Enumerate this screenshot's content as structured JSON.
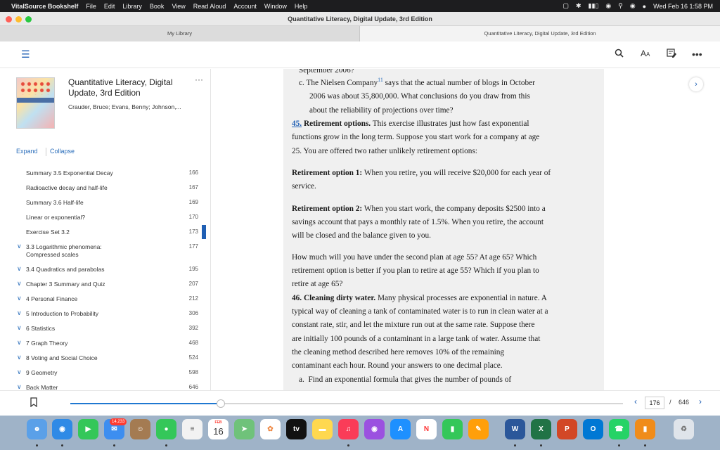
{
  "menubar": {
    "apple": "",
    "app": "VitalSource Bookshelf",
    "items": [
      "File",
      "Edit",
      "Library",
      "Book",
      "View",
      "Read Aloud",
      "Account",
      "Window",
      "Help"
    ],
    "clock": "Wed Feb 16  1:58 PM"
  },
  "window": {
    "title": "Quantitative Literacy, Digital Update,  3rd Edition",
    "tabs": [
      "My Library",
      "Quantitative Literacy, Digital Update,  3rd Edition"
    ]
  },
  "sidebar": {
    "book_title": "Quantitative Literacy, Digital Update,  3rd Edition",
    "authors": "Crauder, Bruce; Evans, Benny; Johnson,...",
    "more": "···",
    "expand": "Expand",
    "collapse": "Collapse",
    "toc": [
      {
        "label": "Summary 3.5 Exponential Decay",
        "page": "166",
        "chev": ""
      },
      {
        "label": "Radioactive decay and half-life",
        "page": "167",
        "chev": ""
      },
      {
        "label": "Summary 3.6 Half-life",
        "page": "169",
        "chev": ""
      },
      {
        "label": "Linear or exponential?",
        "page": "170",
        "chev": ""
      },
      {
        "label": "Exercise Set 3.2",
        "page": "173",
        "chev": ""
      },
      {
        "label": "3.3 Logarithmic phenomena:",
        "label2": "Compressed scales",
        "page": "177",
        "chev": "∨"
      },
      {
        "label": "3.4 Quadratics and parabolas",
        "page": "195",
        "chev": "∨"
      },
      {
        "label": "Chapter 3 Summary and Quiz",
        "page": "207",
        "chev": "∨"
      },
      {
        "label": "4 Personal Finance",
        "page": "212",
        "chev": "∨"
      },
      {
        "label": "5 Introduction to Probability",
        "page": "306",
        "chev": "∨"
      },
      {
        "label": "6 Statistics",
        "page": "392",
        "chev": "∨"
      },
      {
        "label": "7 Graph Theory",
        "page": "468",
        "chev": "∨"
      },
      {
        "label": "8 Voting and Social Choice",
        "page": "524",
        "chev": "∨"
      },
      {
        "label": "9 Geometry",
        "page": "598",
        "chev": "∨"
      },
      {
        "label": "Back Matter",
        "page": "646",
        "chev": "∨"
      }
    ]
  },
  "content": {
    "l0": "September 2006?",
    "c_label": "c.",
    "c_1a": "The Nielsen Company",
    "c_sup": "11",
    "c_1b": " says that the actual number of blogs in October",
    "c_2": "2006 was about 35,800,000. What conclusions do you draw from this",
    "c_3": "about the reliability of projections over time?",
    "q45_num": "45.",
    "q45_title": " Retirement options.",
    "q45_1": " This exercise illustrates just how fast exponential",
    "q45_2": "functions grow in the long term. Suppose you start work for a company at age",
    "q45_3": "25. You are offered two rather unlikely retirement options:",
    "opt1_title": "Retirement option 1:",
    "opt1_1": " When you retire, you will receive $20,000 for each year of",
    "opt1_2": "service.",
    "opt2_title": "Retirement option 2:",
    "opt2_1": " When you start work, the company deposits $2500 into a",
    "opt2_2": "savings account that pays a monthly rate of 1.5%. When you retire, the account",
    "opt2_3": "will be closed and the balance given to you.",
    "q_1": "How much will you have under the second plan at age 55? At age 65? Which",
    "q_2": "retirement option is better if you plan to retire at age 55? Which if you plan to",
    "q_3": "retire at age 65?",
    "q46_title": "46. Cleaning dirty water.",
    "q46_1": " Many physical processes are exponential in nature. A",
    "q46_2": "typical way of cleaning a tank of contaminated water is to run in clean water at a",
    "q46_3": "constant rate, stir, and let the mixture run out at the same rate. Suppose there",
    "q46_4": "are initially 100 pounds of a contaminant in a large tank of water. Assume that",
    "q46_5": "the cleaning method described here removes 10% of the remaining",
    "q46_6": "contaminant each hour. Round your answers to one decimal place.",
    "a_label": "a.",
    "a_1": "Find an exponential formula that gives the number of pounds of"
  },
  "footer": {
    "progress": 0.272,
    "current_page": "176",
    "separator": "/",
    "total_pages": "646"
  },
  "dock": {
    "mail_badge": "14,233",
    "calendar_month": "FEB",
    "calendar_day": "16",
    "tv": "tv"
  },
  "colors": {
    "accent": "#1f5fb4",
    "link": "#2a6ebb",
    "progress": "#1f78d1"
  }
}
